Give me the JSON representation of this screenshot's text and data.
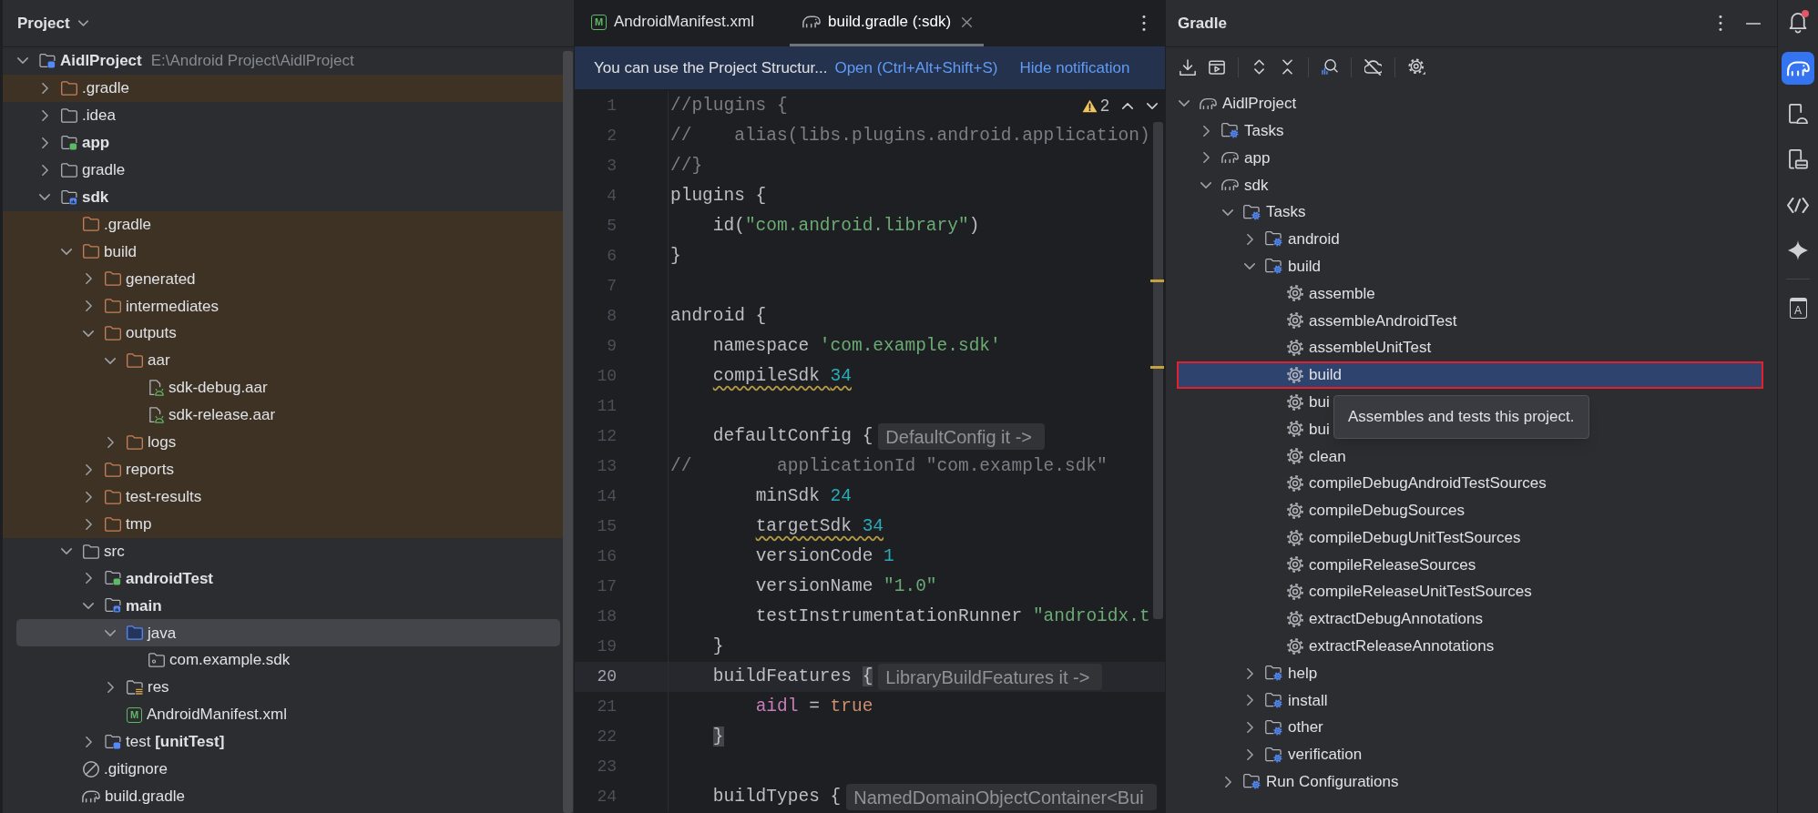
{
  "project_panel": {
    "title": "Project",
    "tree": [
      {
        "label": "AidlProject",
        "path": "E:\\Android Project\\AidlProject",
        "kind": "module",
        "color": "#548af7",
        "bold": true,
        "expanded": true,
        "excluded": false,
        "selected": false,
        "children": [
          {
            "label": ".gradle",
            "kind": "folder",
            "expanded": false,
            "excluded": true,
            "selected": false
          },
          {
            "label": ".idea",
            "kind": "folder",
            "expanded": false,
            "excluded": false,
            "selected": false
          },
          {
            "label": "app",
            "kind": "module",
            "color": "#5fb865",
            "bold": true,
            "expanded": false,
            "excluded": false,
            "selected": false
          },
          {
            "label": "gradle",
            "kind": "folder",
            "expanded": false,
            "excluded": false,
            "selected": false
          },
          {
            "label": "sdk",
            "kind": "library",
            "color": "#548af7",
            "bold": true,
            "expanded": true,
            "excluded": false,
            "selected": false,
            "children": [
              {
                "label": ".gradle",
                "kind": "folder",
                "excluded": true,
                "selected": false
              },
              {
                "label": "build",
                "kind": "folder",
                "expanded": true,
                "excluded": true,
                "selected": false,
                "children": [
                  {
                    "label": "generated",
                    "kind": "folder",
                    "expanded": false,
                    "excluded": true,
                    "selected": false
                  },
                  {
                    "label": "intermediates",
                    "kind": "folder",
                    "expanded": false,
                    "excluded": true,
                    "selected": false
                  },
                  {
                    "label": "outputs",
                    "kind": "folder",
                    "expanded": true,
                    "excluded": true,
                    "selected": false,
                    "children": [
                      {
                        "label": "aar",
                        "kind": "folder",
                        "expanded": true,
                        "excluded": true,
                        "selected": false,
                        "children": [
                          {
                            "label": "sdk-debug.aar",
                            "kind": "aar",
                            "excluded": true,
                            "selected": false
                          },
                          {
                            "label": "sdk-release.aar",
                            "kind": "aar",
                            "excluded": true,
                            "selected": false
                          }
                        ]
                      },
                      {
                        "label": "logs",
                        "kind": "folder",
                        "expanded": false,
                        "excluded": true,
                        "selected": false
                      }
                    ]
                  },
                  {
                    "label": "reports",
                    "kind": "folder",
                    "expanded": false,
                    "excluded": true,
                    "selected": false
                  },
                  {
                    "label": "test-results",
                    "kind": "folder",
                    "expanded": false,
                    "excluded": true,
                    "selected": false
                  },
                  {
                    "label": "tmp",
                    "kind": "folder",
                    "expanded": false,
                    "excluded": true,
                    "selected": false
                  }
                ]
              },
              {
                "label": "src",
                "kind": "folder",
                "expanded": true,
                "excluded": false,
                "selected": false,
                "children": [
                  {
                    "label": "androidTest",
                    "kind": "module",
                    "color": "#5fb865",
                    "bold": true,
                    "expanded": false,
                    "excluded": false,
                    "selected": false
                  },
                  {
                    "label": "main",
                    "kind": "library",
                    "color": "#548af7",
                    "bold": true,
                    "expanded": true,
                    "excluded": false,
                    "selected": false,
                    "children": [
                      {
                        "label": "java",
                        "kind": "source",
                        "expanded": true,
                        "excluded": false,
                        "selected": true,
                        "children": [
                          {
                            "label": "com.example.sdk",
                            "kind": "package",
                            "excluded": false,
                            "selected": false
                          }
                        ]
                      },
                      {
                        "label": "res",
                        "kind": "resources",
                        "expanded": false,
                        "excluded": false,
                        "selected": false
                      },
                      {
                        "label": "AndroidManifest.xml",
                        "kind": "manifest",
                        "badge": "M",
                        "excluded": false,
                        "selected": false
                      }
                    ]
                  },
                  {
                    "label": "test **[unitTest]**",
                    "kind": "module",
                    "color": "#548af7",
                    "expanded": false,
                    "excluded": false,
                    "selected": false
                  }
                ]
              },
              {
                "label": ".gitignore",
                "kind": "ignore",
                "excluded": false,
                "selected": false
              },
              {
                "label": "build.gradle",
                "kind": "gradle",
                "excluded": false,
                "selected": false
              }
            ]
          }
        ]
      }
    ]
  },
  "editor": {
    "tabs": [
      {
        "label": "AndroidManifest.xml",
        "kind": "manifest",
        "badge": "M",
        "selected": false
      },
      {
        "label": "build.gradle (:sdk)",
        "kind": "gradle",
        "selected": true
      }
    ],
    "notification": {
      "message": "You can use the Project Structur...",
      "links": [
        "Open (Ctrl+Alt+Shift+S)",
        "Hide notification"
      ]
    },
    "warnings": "2",
    "lines": [
      {
        "number": "1",
        "tokens": [
          {
            "text": "//plugins {",
            "kind": "comment"
          }
        ]
      },
      {
        "number": "2",
        "tokens": [
          {
            "text": "//    alias(libs.plugins.android.application)",
            "kind": "comment"
          }
        ]
      },
      {
        "number": "3",
        "tokens": [
          {
            "text": "//}",
            "kind": "comment"
          }
        ]
      },
      {
        "number": "4",
        "tokens": [
          {
            "text": "plugins {",
            "kind": "plain"
          }
        ]
      },
      {
        "number": "5",
        "tokens": [
          {
            "text": "    id(",
            "kind": "plain"
          },
          {
            "text": "\"com.android.library\"",
            "kind": "string"
          },
          {
            "text": ")",
            "kind": "plain"
          }
        ]
      },
      {
        "number": "6",
        "tokens": [
          {
            "text": "}",
            "kind": "plain"
          }
        ]
      },
      {
        "number": "7"
      },
      {
        "number": "8",
        "tokens": [
          {
            "text": "android {",
            "kind": "plain"
          }
        ]
      },
      {
        "number": "9",
        "tokens": [
          {
            "text": "    namespace ",
            "kind": "plain"
          },
          {
            "text": "'com.example.sdk'",
            "kind": "string"
          }
        ]
      },
      {
        "number": "10",
        "tokens": [
          {
            "text": "    compileSdk ",
            "kind": "plain",
            "warn": true
          },
          {
            "text": "34",
            "kind": "number",
            "warn": true
          }
        ]
      },
      {
        "number": "11"
      },
      {
        "number": "12",
        "tokens": [
          {
            "text": "    defaultConfig {",
            "kind": "plain"
          }
        ],
        "hint": "DefaultConfig it ->"
      },
      {
        "number": "13",
        "tokens": [
          {
            "text": "//        applicationId \"com.example.sdk\"",
            "kind": "comment"
          }
        ]
      },
      {
        "number": "14",
        "tokens": [
          {
            "text": "        minSdk ",
            "kind": "plain"
          },
          {
            "text": "24",
            "kind": "number"
          }
        ]
      },
      {
        "number": "15",
        "tokens": [
          {
            "text": "        targetSdk ",
            "kind": "plain",
            "warn": true
          },
          {
            "text": "34",
            "kind": "number",
            "warn": true
          }
        ]
      },
      {
        "number": "16",
        "tokens": [
          {
            "text": "        versionCode ",
            "kind": "plain"
          },
          {
            "text": "1",
            "kind": "number"
          }
        ]
      },
      {
        "number": "17",
        "tokens": [
          {
            "text": "        versionName ",
            "kind": "plain"
          },
          {
            "text": "\"1.0\"",
            "kind": "string"
          }
        ]
      },
      {
        "number": "18",
        "tokens": [
          {
            "text": "        testInstrumentationRunner ",
            "kind": "plain"
          },
          {
            "text": "\"androidx.t",
            "kind": "string"
          }
        ]
      },
      {
        "number": "19",
        "tokens": [
          {
            "text": "    }",
            "kind": "plain"
          }
        ]
      },
      {
        "number": "20",
        "current": true,
        "tokens": [
          {
            "text": "    buildFeatures ",
            "kind": "plain"
          },
          {
            "text": "{",
            "kind": "brace"
          }
        ],
        "hint": "LibraryBuildFeatures it ->"
      },
      {
        "number": "21",
        "tokens": [
          {
            "text": "        aidl",
            "kind": "property"
          },
          {
            "text": " = ",
            "kind": "plain"
          },
          {
            "text": "true",
            "kind": "keyword"
          }
        ]
      },
      {
        "number": "22",
        "tokens": [
          {
            "text": "    }",
            "kind": "brace"
          }
        ]
      },
      {
        "number": "23"
      },
      {
        "number": "24",
        "tokens": [
          {
            "text": "    buildTypes {",
            "kind": "plain"
          }
        ],
        "hint": "NamedDomainObjectContainer<Bui"
      }
    ]
  },
  "gradle_panel": {
    "title": "Gradle",
    "toolbar": [
      {
        "kind": "download"
      },
      {
        "kind": "run-window"
      },
      {
        "kind": "divider"
      },
      {
        "kind": "expand"
      },
      {
        "kind": "collapse"
      },
      {
        "kind": "divider"
      },
      {
        "kind": "analyze"
      },
      {
        "kind": "divider"
      },
      {
        "kind": "offline"
      },
      {
        "kind": "divider"
      },
      {
        "kind": "settings"
      }
    ],
    "selection_outline": true,
    "tooltip": "Assembles and tests this project.",
    "tree": [
      {
        "label": "AidlProject",
        "kind": "gradle",
        "expanded": true,
        "selected": false,
        "children": [
          {
            "label": "Tasks",
            "kind": "task-group",
            "expanded": false,
            "selected": false
          },
          {
            "label": "app",
            "kind": "gradle",
            "expanded": false,
            "selected": false
          },
          {
            "label": "sdk",
            "kind": "gradle",
            "expanded": true,
            "selected": false,
            "children": [
              {
                "label": "Tasks",
                "kind": "task-group",
                "expanded": true,
                "selected": false,
                "children": [
                  {
                    "label": "android",
                    "kind": "task-group",
                    "expanded": false,
                    "selected": false
                  },
                  {
                    "label": "build",
                    "kind": "task-group",
                    "expanded": true,
                    "selected": false,
                    "children": [
                      {
                        "label": "assemble",
                        "kind": "task",
                        "selected": false
                      },
                      {
                        "label": "assembleAndroidTest",
                        "kind": "task",
                        "selected": false
                      },
                      {
                        "label": "assembleUnitTest",
                        "kind": "task",
                        "selected": false
                      },
                      {
                        "label": "build",
                        "kind": "task",
                        "selected": true
                      },
                      {
                        "label": "bui",
                        "kind": "task",
                        "selected": false
                      },
                      {
                        "label": "bui",
                        "kind": "task",
                        "selected": false
                      },
                      {
                        "label": "clean",
                        "kind": "task",
                        "selected": false
                      },
                      {
                        "label": "compileDebugAndroidTestSources",
                        "kind": "task",
                        "selected": false
                      },
                      {
                        "label": "compileDebugSources",
                        "kind": "task",
                        "selected": false
                      },
                      {
                        "label": "compileDebugUnitTestSources",
                        "kind": "task",
                        "selected": false
                      },
                      {
                        "label": "compileReleaseSources",
                        "kind": "task",
                        "selected": false
                      },
                      {
                        "label": "compileReleaseUnitTestSources",
                        "kind": "task",
                        "selected": false
                      },
                      {
                        "label": "extractDebugAnnotations",
                        "kind": "task",
                        "selected": false
                      },
                      {
                        "label": "extractReleaseAnnotations",
                        "kind": "task",
                        "selected": false
                      }
                    ]
                  },
                  {
                    "label": "help",
                    "kind": "task-group",
                    "expanded": false,
                    "selected": false
                  },
                  {
                    "label": "install",
                    "kind": "task-group",
                    "expanded": false,
                    "selected": false
                  },
                  {
                    "label": "other",
                    "kind": "task-group",
                    "expanded": false,
                    "selected": false
                  },
                  {
                    "label": "verification",
                    "kind": "task-group",
                    "expanded": false,
                    "selected": false
                  }
                ]
              },
              {
                "label": "Run Configurations",
                "kind": "task-group",
                "expanded": false,
                "selected": false
              }
            ]
          }
        ]
      }
    ]
  },
  "tool_strip": {
    "main": [
      {
        "kind": "bell",
        "unread": true,
        "selected": false
      },
      {
        "kind": "gradle",
        "selected": true
      },
      {
        "kind": "device",
        "selected": false
      },
      {
        "kind": "mirror",
        "selected": false
      },
      {
        "kind": "code",
        "selected": false
      },
      {
        "kind": "sparkle",
        "selected": false
      }
    ],
    "extra": [
      {
        "kind": "book",
        "letter": "A",
        "selected": false
      }
    ]
  }
}
